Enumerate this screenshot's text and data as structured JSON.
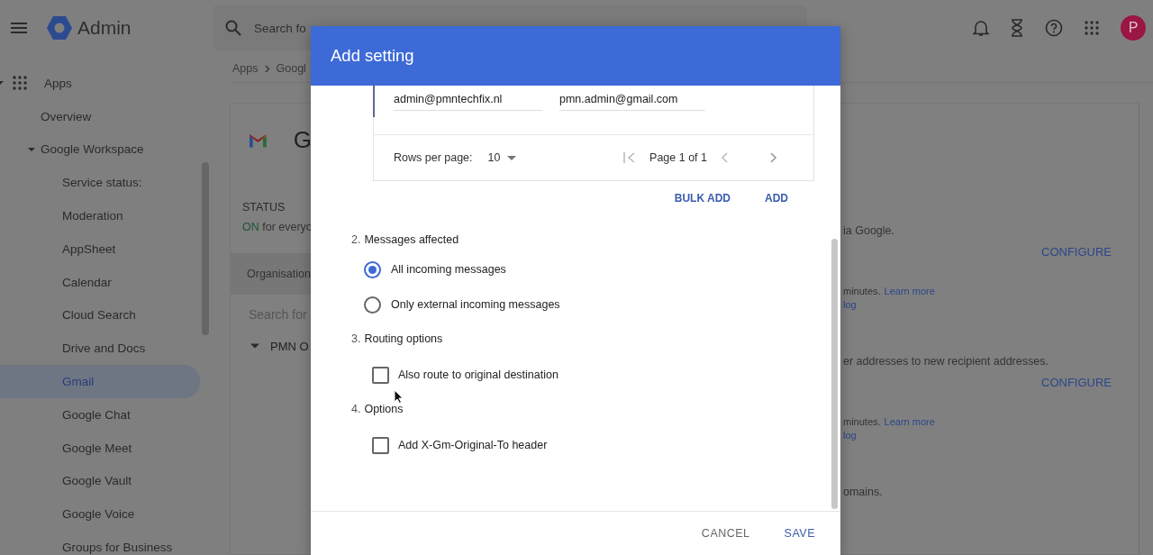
{
  "topbar": {
    "brand": "Admin",
    "search_placeholder": "Search fo",
    "avatar": "P"
  },
  "sidebar": {
    "items": [
      {
        "label": "Apps",
        "expanded": true,
        "selected": false,
        "children": [
          {
            "label": "Overview",
            "selected": false
          },
          {
            "label": "Google Workspace",
            "expanded": true,
            "selected": false,
            "children": [
              {
                "label": "Service status:",
                "selected": false
              },
              {
                "label": "Moderation",
                "selected": false
              },
              {
                "label": "AppSheet",
                "selected": false
              },
              {
                "label": "Calendar",
                "selected": false
              },
              {
                "label": "Cloud Search",
                "selected": false
              },
              {
                "label": "Drive and Docs",
                "selected": false
              },
              {
                "label": "Gmail",
                "selected": true
              },
              {
                "label": "Google Chat",
                "selected": false
              },
              {
                "label": "Google Meet",
                "selected": false
              },
              {
                "label": "Google Vault",
                "selected": false
              },
              {
                "label": "Google Voice",
                "selected": false
              },
              {
                "label": "Groups for Business",
                "selected": false
              }
            ]
          }
        ]
      }
    ]
  },
  "breadcrumb": [
    "Apps",
    "Googl"
  ],
  "app_card": {
    "title": "G",
    "status_heading": "STATUS",
    "status_value": "ON",
    "status_scope": "for everyo",
    "org_tab": "Organisation",
    "search_placeholder": "Search for",
    "tree": [
      {
        "label": "PMN O",
        "expanded": true
      }
    ]
  },
  "right_panel": [
    {
      "kind": "text",
      "text": "ia Google."
    },
    {
      "kind": "action",
      "text": "CONFIGURE"
    },
    {
      "kind": "note",
      "text": "minutes.",
      "link": "Learn more"
    },
    {
      "kind": "link",
      "text": "log"
    },
    {
      "kind": "text",
      "text": "er addresses to new recipient addresses."
    },
    {
      "kind": "action",
      "text": "CONFIGURE"
    },
    {
      "kind": "note",
      "text": "minutes.",
      "link": "Learn more"
    },
    {
      "kind": "link",
      "text": "log"
    },
    {
      "kind": "text",
      "text": "omains."
    }
  ],
  "dialog": {
    "title": "Add setting",
    "table": {
      "rows": [
        {
          "cells": [
            "admin@pmntechfix.nl",
            "pmn.admin@gmail.com"
          ]
        }
      ],
      "rows_per_page_label": "Rows per page:",
      "rows_per_page": "10",
      "page_label": "Page 1 of 1"
    },
    "table_actions": [
      "BULK ADD",
      "ADD"
    ],
    "sections": [
      {
        "number": "2.",
        "title": "Messages affected",
        "options": [
          {
            "kind": "radio",
            "label": "All incoming messages",
            "selected": true
          },
          {
            "kind": "radio",
            "label": "Only external incoming messages",
            "selected": false
          }
        ]
      },
      {
        "number": "3.",
        "title": "Routing options",
        "options": [
          {
            "kind": "checkbox",
            "label": "Also route to original destination",
            "checked": false
          }
        ]
      },
      {
        "number": "4.",
        "title": "Options",
        "options": [
          {
            "kind": "checkbox",
            "label": "Add X-Gm-Original-To header",
            "checked": false
          }
        ]
      }
    ],
    "buttons": [
      "CANCEL",
      "SAVE"
    ]
  }
}
